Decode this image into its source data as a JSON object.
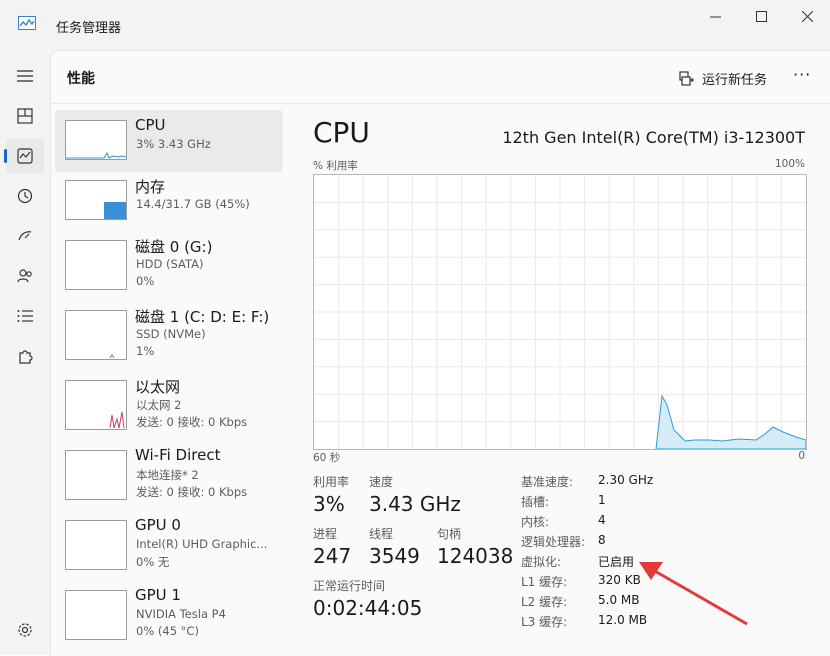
{
  "app": {
    "title": "任务管理器"
  },
  "header": {
    "title": "性能",
    "run_new_task": "运行新任务",
    "more": "···"
  },
  "devices": [
    {
      "name": "CPU",
      "sub1": "3% 3.43 GHz",
      "sub2": ""
    },
    {
      "name": "内存",
      "sub1": "14.4/31.7 GB (45%)",
      "sub2": ""
    },
    {
      "name": "磁盘 0 (G:)",
      "sub1": "HDD (SATA)",
      "sub2": "0%"
    },
    {
      "name": "磁盘 1 (C: D: E: F:)",
      "sub1": "SSD (NVMe)",
      "sub2": "1%"
    },
    {
      "name": "以太网",
      "sub1": "以太网 2",
      "sub2": "发送: 0 接收: 0 Kbps"
    },
    {
      "name": "Wi-Fi Direct",
      "sub1": "本地连接* 2",
      "sub2": "发送: 0 接收: 0 Kbps"
    },
    {
      "name": "GPU 0",
      "sub1": "Intel(R) UHD Graphic...",
      "sub2": "0% 无"
    },
    {
      "name": "GPU 1",
      "sub1": "NVIDIA Tesla P4",
      "sub2": "0% (45 °C)"
    }
  ],
  "detail": {
    "title": "CPU",
    "model": "12th Gen Intel(R) Core(TM) i3-12300T",
    "graph_label_left": "% 利用率",
    "graph_label_right": "100%",
    "time_left": "60 秒",
    "time_right": "0",
    "utilization_label": "利用率",
    "utilization_value": "3%",
    "speed_label": "速度",
    "speed_value": "3.43 GHz",
    "processes_label": "进程",
    "processes_value": "247",
    "threads_label": "线程",
    "threads_value": "3549",
    "handles_label": "句柄",
    "handles_value": "124038",
    "uptime_label": "正常运行时间",
    "uptime_value": "0:02:44:05",
    "specs": [
      {
        "key": "基准速度:",
        "value": "2.30 GHz"
      },
      {
        "key": "插槽:",
        "value": "1"
      },
      {
        "key": "内核:",
        "value": "4"
      },
      {
        "key": "逻辑处理器:",
        "value": "8"
      },
      {
        "key": "虚拟化:",
        "value": "已启用"
      },
      {
        "key": "L1 缓存:",
        "value": "320 KB"
      },
      {
        "key": "L2 缓存:",
        "value": "5.0 MB"
      },
      {
        "key": "L3 缓存:",
        "value": "12.0 MB"
      }
    ]
  },
  "colors": {
    "cpu_line": "#2d9ad6",
    "cpu_fill": "#d5ecf8",
    "mem_fill": "#3a8fd8",
    "eth": "#c8405e",
    "arrow": "#e53935"
  }
}
